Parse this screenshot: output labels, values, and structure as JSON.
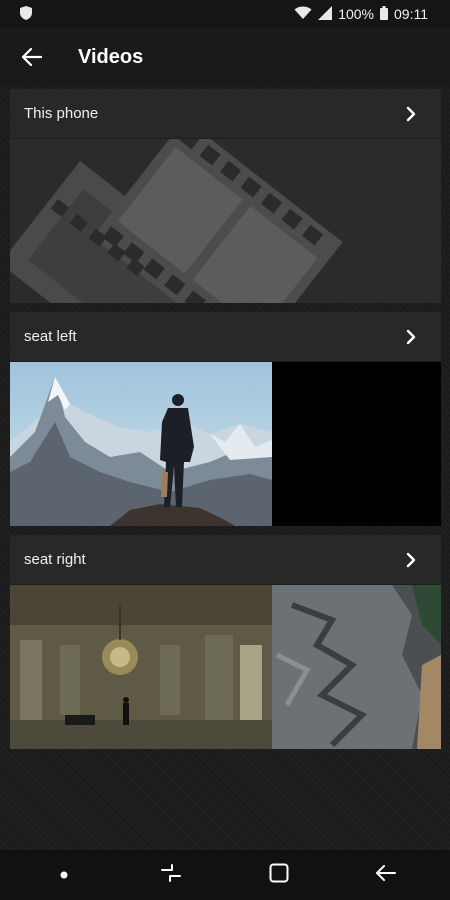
{
  "status_bar": {
    "battery": "100%",
    "time": "09:11",
    "icons": [
      "shield-icon",
      "wifi-icon",
      "signal-icon",
      "battery-icon"
    ]
  },
  "app_bar": {
    "title": "Videos",
    "back_icon": "arrow-left-icon"
  },
  "sections": [
    {
      "title": "This phone",
      "thumbnail": "film-strip-placeholder"
    },
    {
      "title": "seat left",
      "thumbnail": "mountain-man-photo"
    },
    {
      "title": "seat right",
      "thumbnail": "hall-and-cliff-photos"
    }
  ],
  "nav_bar": {
    "buttons": [
      "dot-icon",
      "recent-apps-icon",
      "home-icon",
      "back-icon"
    ]
  },
  "colors": {
    "background": "#1c1c1c",
    "card": "#2a2a2a",
    "text": "#ffffff"
  }
}
